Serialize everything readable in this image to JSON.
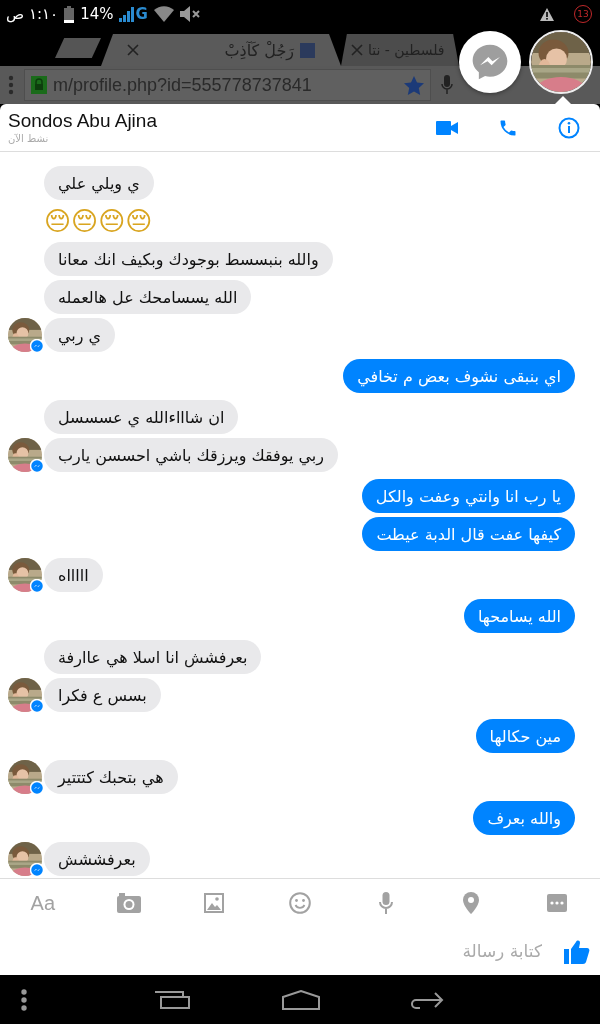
{
  "status_bar": {
    "time": "١:١٠ ص",
    "battery": "14%",
    "network": "G",
    "notification_count": "13"
  },
  "browser": {
    "tabs": [
      {
        "title": "فلسطين - نتا",
        "selected": false
      },
      {
        "title": "رَجُلْ كَآذِبْ",
        "selected": true
      }
    ],
    "url": "m/profile.php?id=555778737841"
  },
  "conversation": {
    "name": "Sondos Abu Ajina",
    "status": "نشط الآن"
  },
  "groups": [
    {
      "kind": "incoming",
      "messages": [
        {
          "kind": "text",
          "text": "ي ويلي علي"
        },
        {
          "kind": "emoji",
          "text": "😔😔😔😔"
        },
        {
          "kind": "text",
          "text": "والله بنبسسط بوجودك وبكيف انك معانا"
        },
        {
          "kind": "text",
          "text": "الله يسسامحك عل هالعمله"
        },
        {
          "kind": "text",
          "text": "ي ربي"
        }
      ]
    },
    {
      "kind": "outgoing",
      "messages": [
        {
          "kind": "text",
          "text": "اي بنبقى نشوف بعض م تخافي"
        }
      ]
    },
    {
      "kind": "incoming",
      "messages": [
        {
          "kind": "text",
          "text": "ان شاااءالله ي عسسسل"
        },
        {
          "kind": "text",
          "text": "ربي يوفقك ويرزقك باشي احسسن يارب"
        }
      ]
    },
    {
      "kind": "outgoing",
      "messages": [
        {
          "kind": "text",
          "text": "يا رب انا وانتي وعفت والكل"
        },
        {
          "kind": "text",
          "text": "كيفها عفت قال الدبة عيطت"
        }
      ]
    },
    {
      "kind": "incoming",
      "messages": [
        {
          "kind": "text",
          "text": "اااااه"
        }
      ]
    },
    {
      "kind": "outgoing",
      "messages": [
        {
          "kind": "text",
          "text": "الله يسامحها"
        }
      ]
    },
    {
      "kind": "incoming",
      "messages": [
        {
          "kind": "text",
          "text": "بعرفشش انا اسلا هي عاارفة"
        },
        {
          "kind": "text",
          "text": "بسس ع فكرا"
        }
      ]
    },
    {
      "kind": "outgoing",
      "messages": [
        {
          "kind": "text",
          "text": "مين حكالها"
        }
      ]
    },
    {
      "kind": "incoming",
      "messages": [
        {
          "kind": "text",
          "text": "هي بتحبك كتتتير"
        }
      ]
    },
    {
      "kind": "outgoing",
      "messages": [
        {
          "kind": "text",
          "text": "والله بعرف"
        }
      ]
    },
    {
      "kind": "incoming",
      "messages": [
        {
          "kind": "text",
          "text": "بعرفششش"
        }
      ]
    }
  ],
  "composer": {
    "format_label": "Aa",
    "placeholder": "كتابة رسالة"
  }
}
